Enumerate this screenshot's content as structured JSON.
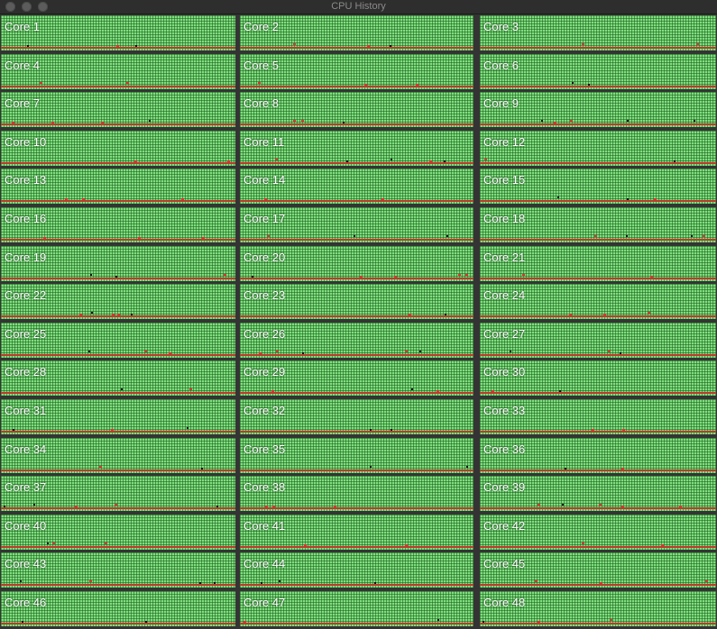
{
  "window": {
    "title": "CPU History"
  },
  "cores": [
    {
      "label": "Core 1"
    },
    {
      "label": "Core 2"
    },
    {
      "label": "Core 3"
    },
    {
      "label": "Core 4"
    },
    {
      "label": "Core 5"
    },
    {
      "label": "Core 6"
    },
    {
      "label": "Core 7"
    },
    {
      "label": "Core 8"
    },
    {
      "label": "Core 9"
    },
    {
      "label": "Core 10"
    },
    {
      "label": "Core 11"
    },
    {
      "label": "Core 12"
    },
    {
      "label": "Core 13"
    },
    {
      "label": "Core 14"
    },
    {
      "label": "Core 15"
    },
    {
      "label": "Core 16"
    },
    {
      "label": "Core 17"
    },
    {
      "label": "Core 18"
    },
    {
      "label": "Core 19"
    },
    {
      "label": "Core 20"
    },
    {
      "label": "Core 21"
    },
    {
      "label": "Core 22"
    },
    {
      "label": "Core 23"
    },
    {
      "label": "Core 24"
    },
    {
      "label": "Core 25"
    },
    {
      "label": "Core 26"
    },
    {
      "label": "Core 27"
    },
    {
      "label": "Core 28"
    },
    {
      "label": "Core 29"
    },
    {
      "label": "Core 30"
    },
    {
      "label": "Core 31"
    },
    {
      "label": "Core 32"
    },
    {
      "label": "Core 33"
    },
    {
      "label": "Core 34"
    },
    {
      "label": "Core 35"
    },
    {
      "label": "Core 36"
    },
    {
      "label": "Core 37"
    },
    {
      "label": "Core 38"
    },
    {
      "label": "Core 39"
    },
    {
      "label": "Core 40"
    },
    {
      "label": "Core 41"
    },
    {
      "label": "Core 42"
    },
    {
      "label": "Core 43"
    },
    {
      "label": "Core 44"
    },
    {
      "label": "Core 45"
    },
    {
      "label": "Core 46"
    },
    {
      "label": "Core 47"
    },
    {
      "label": "Core 48"
    }
  ],
  "colors": {
    "idle_green": "#7ee07e",
    "user_red": "#c0392b",
    "system_black": "#111111",
    "window_bg": "#343434"
  }
}
